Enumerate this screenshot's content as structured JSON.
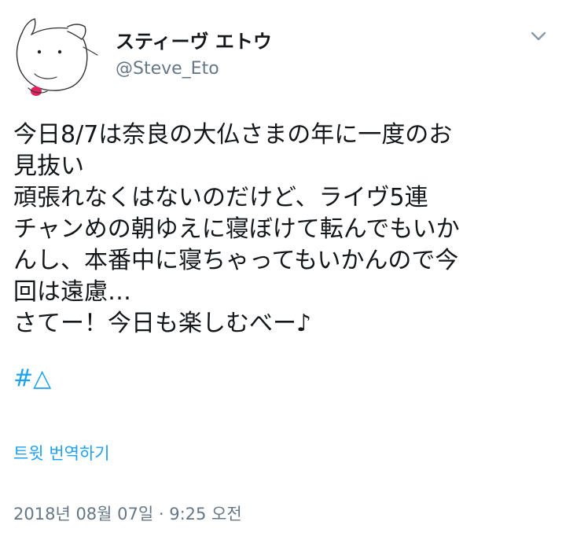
{
  "author": {
    "display_name": "スティーヴ エトウ",
    "handle": "@Steve_Eto",
    "avatar_icon": "dog-drawing-avatar"
  },
  "menu": {
    "icon": "chevron-down-icon"
  },
  "tweet": {
    "lines": [
      "今日8/7は奈良の大仏さまの年に一度のお",
      "見抜い",
      "頑張れなくはないのだけど、ライヴ5連",
      "チャンめの朝ゆえに寝ぼけて転んでもいか",
      "んし、本番中に寝ちゃってもいかんので今",
      "回は遠慮…",
      "さてー！今日も楽しむべー♪"
    ],
    "hashtag": "#△",
    "translate_label": "트윗 번역하기",
    "timestamp": "2018년 08월 07일 · 9:25 오전"
  },
  "colors": {
    "link": "#1da1f2",
    "secondary_text": "#657786",
    "primary_text": "#14171a",
    "avatar_tongue": "#e0245e"
  }
}
